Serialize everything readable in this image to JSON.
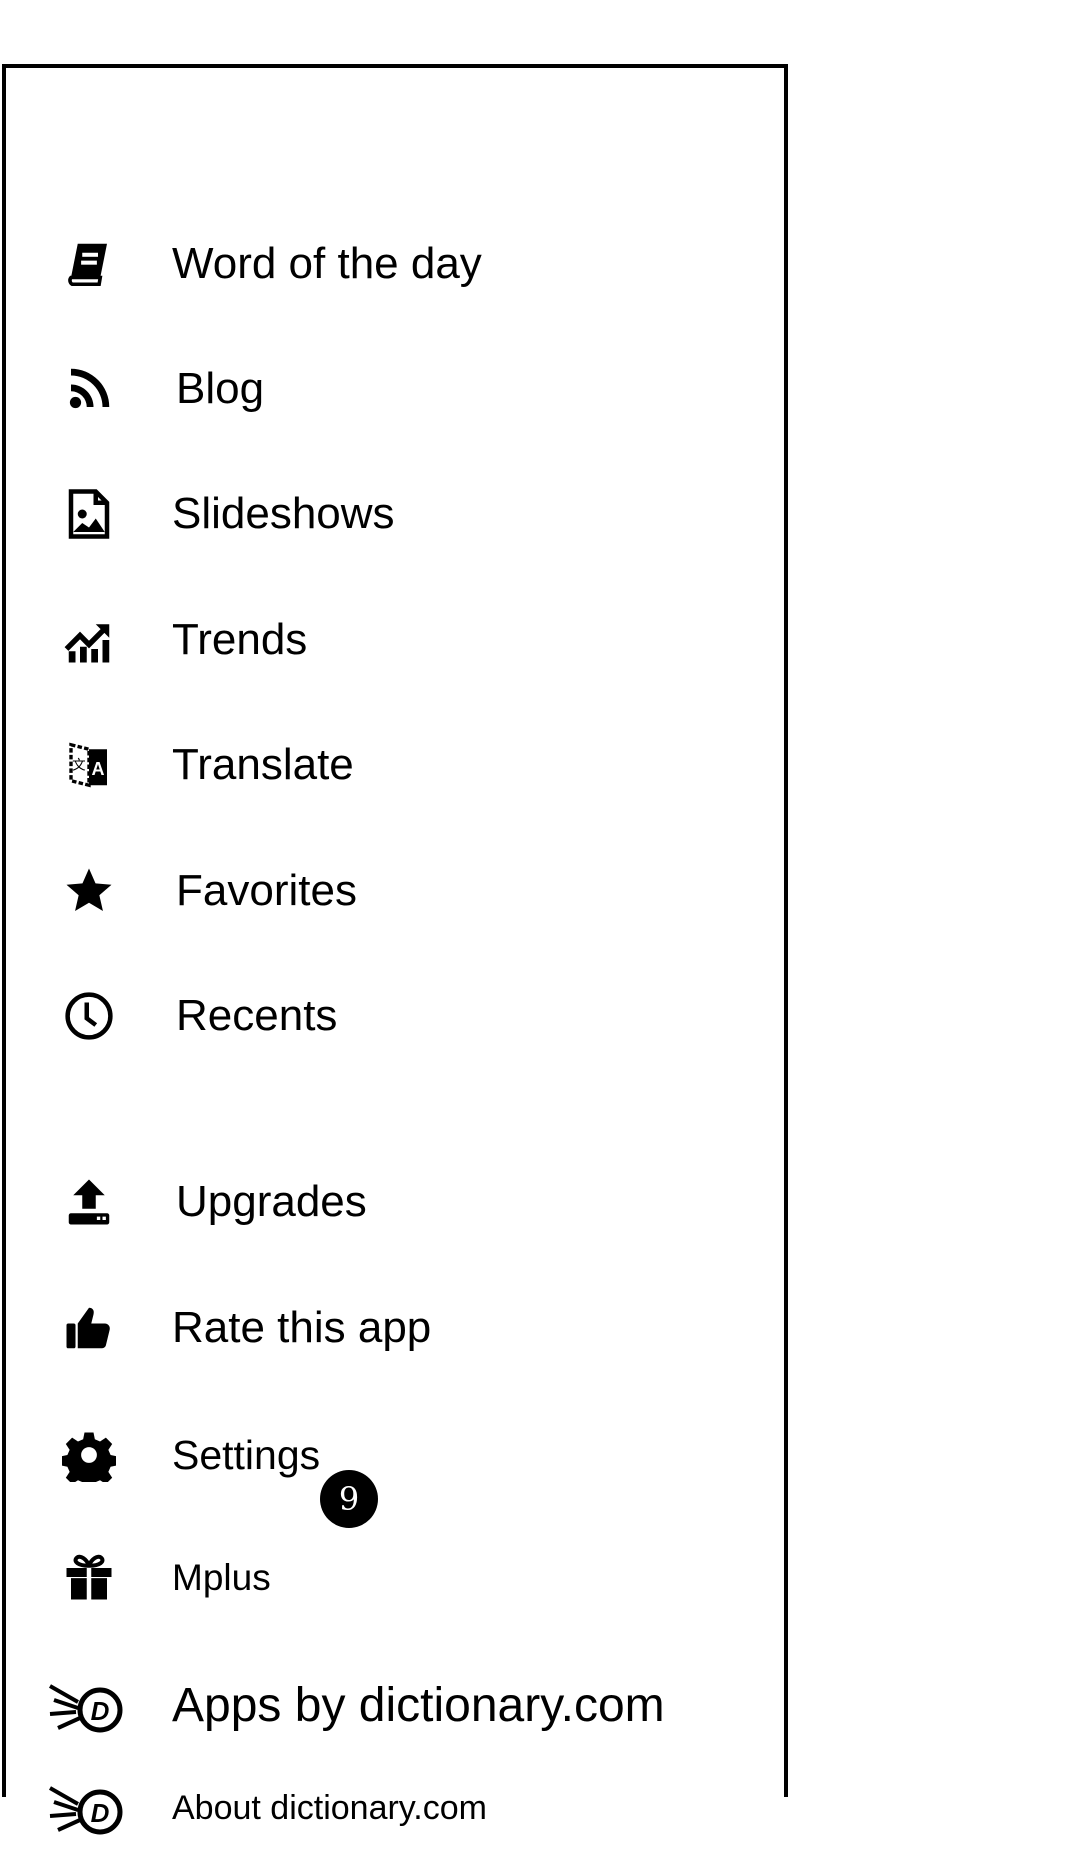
{
  "menu": {
    "items": [
      {
        "label": "Word of the day",
        "icon": "book-icon"
      },
      {
        "label": "Blog",
        "icon": "rss-icon"
      },
      {
        "label": "Slideshows",
        "icon": "image-file-icon"
      },
      {
        "label": "Trends",
        "icon": "trending-up-icon"
      },
      {
        "label": "Translate",
        "icon": "translate-icon"
      },
      {
        "label": "Favorites",
        "icon": "star-icon"
      },
      {
        "label": "Recents",
        "icon": "clock-icon"
      },
      {
        "label": "Upgrades",
        "icon": "upload-icon"
      },
      {
        "label": "Rate this app",
        "icon": "thumbs-up-icon"
      },
      {
        "label": "Settings",
        "icon": "gear-icon"
      },
      {
        "label": "Mplus",
        "icon": "gift-icon",
        "badge": "9"
      },
      {
        "label": "Apps by dictionary.com",
        "icon": "dictionary-logo-icon"
      },
      {
        "label": "About dictionary.com",
        "icon": "dictionary-logo-icon"
      }
    ]
  }
}
